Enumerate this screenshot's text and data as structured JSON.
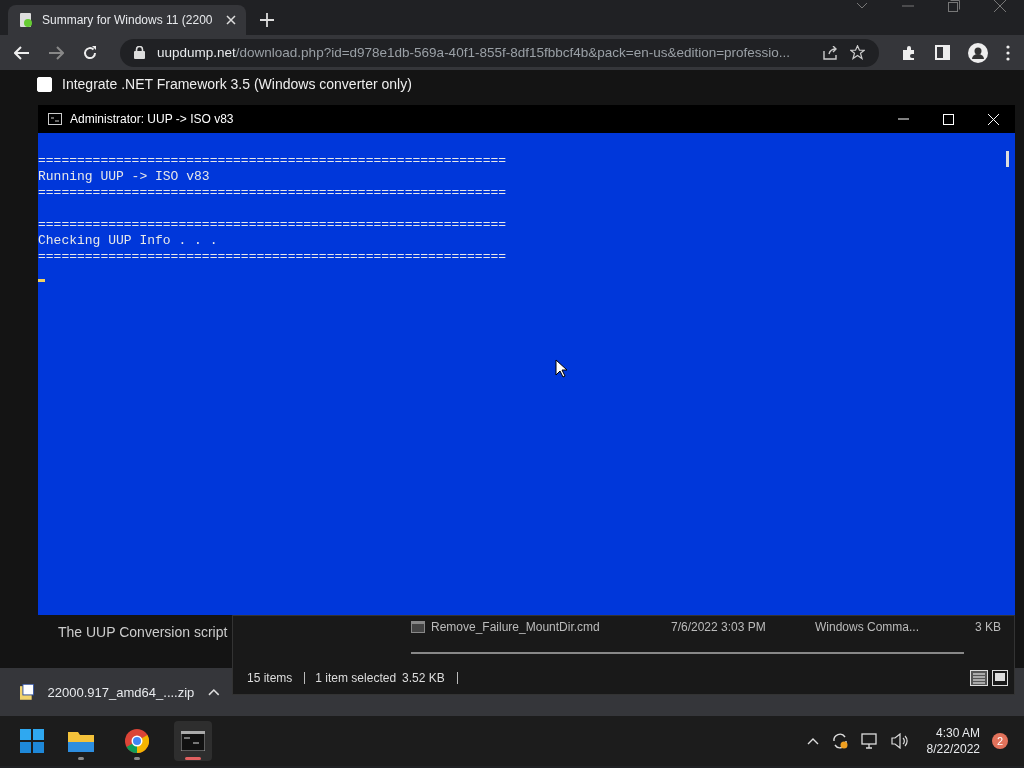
{
  "browser": {
    "tab": {
      "title": "Summary for Windows 11 (2200",
      "selected": true
    },
    "url": {
      "host": "uupdump.net",
      "path": "/download.php?id=d978e1db-569a-40f1-855f-8df15fbbcf4b&pack=en-us&edition=professio..."
    }
  },
  "page": {
    "option": {
      "label": "Integrate .NET Framework 3.5 (Windows converter only)",
      "checked": false
    },
    "text": "The UUP Conversion script"
  },
  "console": {
    "title": "Administrator:  UUP -> ISO v83",
    "blocks": [
      [
        "============================================================",
        "Running UUP -> ISO v83",
        "============================================================"
      ],
      [
        "============================================================",
        "Checking UUP Info . . .",
        "============================================================"
      ]
    ]
  },
  "explorer": {
    "file": {
      "name": "Remove_Failure_MountDir.cmd",
      "date": "7/6/2022 3:03 PM",
      "type": "Windows Comma...",
      "size": "3 KB"
    },
    "status": [
      "15 items",
      "1 item selected",
      "3.52 KB"
    ]
  },
  "downloads": [
    {
      "name": "22000.917_amd64_....zip"
    }
  ],
  "taskbar": {
    "apps": [
      {
        "kind": "folder",
        "active": false,
        "running": true
      },
      {
        "kind": "chrome",
        "active": false,
        "running": true
      },
      {
        "kind": "terminal",
        "active": true,
        "running": true
      }
    ],
    "time": "4:30 AM",
    "date": "8/22/2022",
    "badge": "2"
  }
}
